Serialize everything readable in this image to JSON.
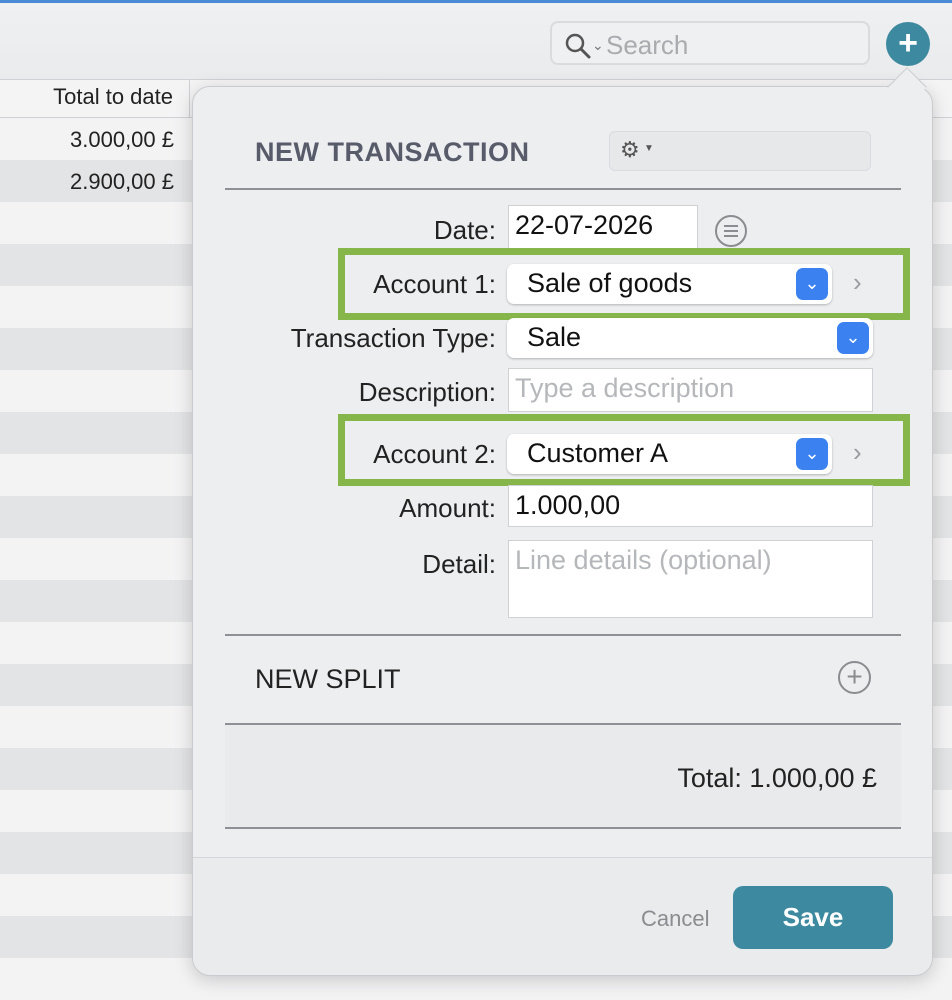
{
  "toolbar": {
    "search_placeholder": "Search",
    "add_label": "+"
  },
  "table": {
    "column_header": "Total to date",
    "rows": [
      {
        "total": "3.000,00 £"
      },
      {
        "total": "2.900,00 £"
      }
    ]
  },
  "popover": {
    "title": "NEW TRANSACTION",
    "date_label": "Date:",
    "date_value": "22-07-2026",
    "account1_label": "Account 1:",
    "account1_value": "Sale of goods",
    "transaction_type_label": "Transaction Type:",
    "transaction_type_value": "Sale",
    "description_label": "Description:",
    "description_placeholder": "Type a description",
    "account2_label": "Account 2:",
    "account2_value": "Customer A",
    "amount_label": "Amount:",
    "amount_value": "1.000,00",
    "detail_label": "Detail:",
    "detail_placeholder": "Line details (optional)",
    "new_split_label": "NEW SPLIT",
    "total_text": "Total: 1.000,00 £",
    "cancel_label": "Cancel",
    "save_label": "Save"
  },
  "colors": {
    "accent": "#3d8aa0",
    "popup_blue": "#3b82f0",
    "highlight_green": "#86b54a"
  }
}
